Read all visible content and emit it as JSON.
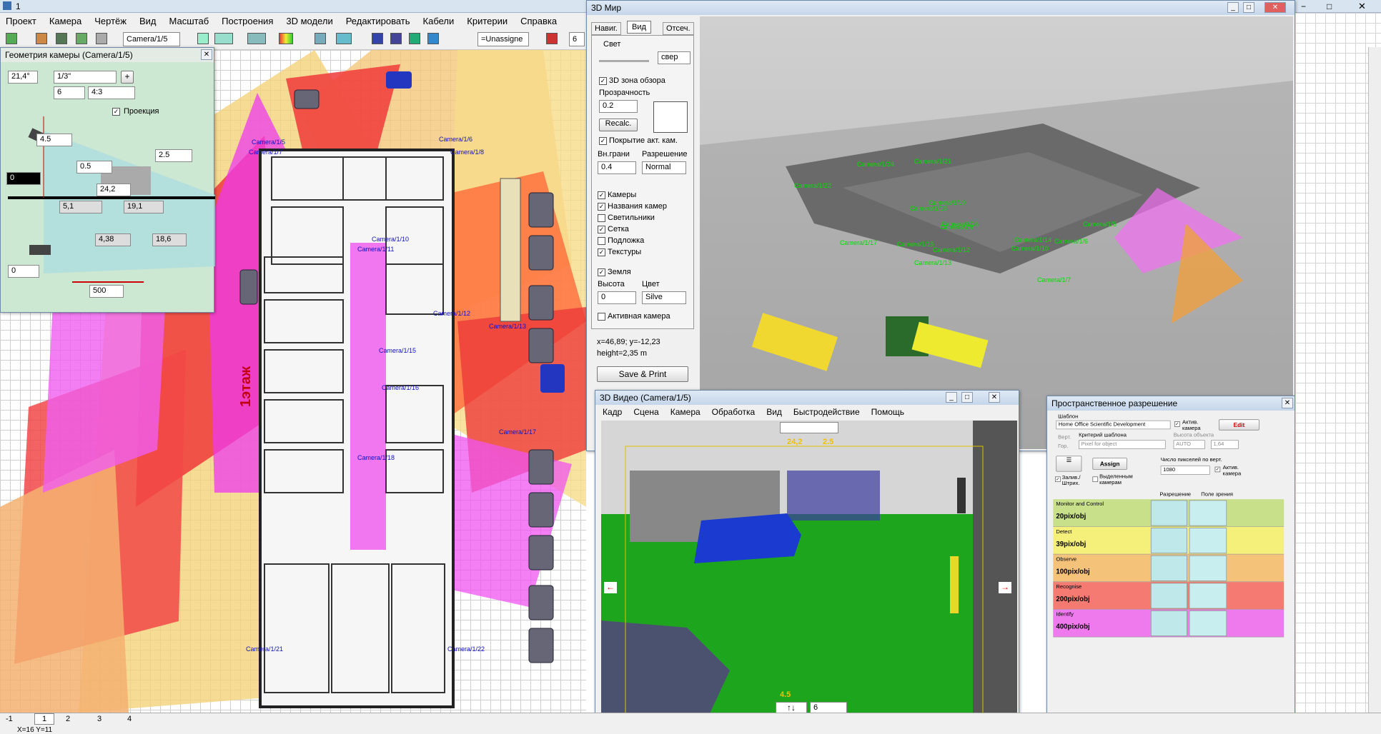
{
  "app": {
    "title": "1",
    "window_controls": [
      "−",
      "□",
      "✕"
    ]
  },
  "menu": [
    "Проект",
    "Камера",
    "Чертёж",
    "Вид",
    "Масштаб",
    "Построения",
    "3D модели",
    "Редактировать",
    "Кабели",
    "Критерии",
    "Справка"
  ],
  "toolbar": {
    "camera_select": "Camera/1/5",
    "layer_select": "=Unassigne",
    "num_select": "6"
  },
  "geometry_panel": {
    "title": "Геометрия камеры (Camera/1/5)",
    "angle": "21,4°",
    "sensor": "1/3\"",
    "focal": "6",
    "aspect": "4:3",
    "projection_label": "Проекция",
    "height": "4.5",
    "tilt_height": "2.5",
    "offset": "0.5",
    "ground": "0",
    "distance": "24,2",
    "val_a": "5,1",
    "val_b": "19,1",
    "val_c": "4,38",
    "val_d": "18,6",
    "rotation": "0",
    "range": "500"
  },
  "floor_label": "1этаж",
  "camera_labels": [
    "Camera/1/5",
    "Camera/1/6",
    "Camera/1/8",
    "Camera/1/10",
    "Camera/1/11",
    "Camera/1/12",
    "Camera/1/13",
    "Camera/1/15",
    "Camera/1/16",
    "Camera/1/17",
    "Camera/1/18",
    "Camera/1/21",
    "Camera/1/22",
    "Camera/1/7"
  ],
  "world3d": {
    "title": "3D Мир",
    "tabs": [
      "Навиг.",
      "Вид",
      "Отсеч."
    ],
    "light_label": "Свет",
    "light_dir": "свер",
    "zone_label": "3D зона обзора",
    "transparency_label": "Прозрачность",
    "transparency_value": "0.2",
    "recalc_label": "Recalc.",
    "coverage_label": "Покрытие акт. кам.",
    "inner_label": "Вн.грани",
    "inner_value": "0.4",
    "resolution_label": "Разрешение",
    "resolution_value": "Normal",
    "checks": [
      "Камеры",
      "Названия камер",
      "Светильники",
      "Сетка",
      "Подложка",
      "Текстуры"
    ],
    "ground_label": "Земля",
    "height_label": "Высота",
    "height_value": "0",
    "color_label": "Цвет",
    "color_value": "Silve",
    "active_camera_label": "Активная камера",
    "coords": "x=46,89;  y=-12,23",
    "height_readout": "height=2,35 m",
    "save_print": "Save & Print",
    "scene_labels": [
      "Camera/1/24",
      "Camera/1/21",
      "Camera/1/22",
      "Camera/1/19",
      "Camera/1/18",
      "Camera/1/16",
      "Camera/1/15",
      "Camera/1/17",
      "Camera/1/12",
      "Camera/1/14",
      "Camera/1/10",
      "Camera/1/13",
      "Camera/1/5",
      "Camera/1/6",
      "Camera/1/7",
      "Camera/1/8"
    ]
  },
  "video3d": {
    "title": "3D Видео (Camera/1/5)",
    "menu": [
      "Кадр",
      "Сцена",
      "Камера",
      "Обработка",
      "Вид",
      "Быстродействие",
      "Помощь"
    ],
    "top_readout_a": "24,2",
    "top_readout_b": "2.5",
    "bottom_readout": "4.5",
    "bottom_select": "6"
  },
  "spatial": {
    "title": "Пространственное разрешение",
    "template_label": "Шаблон",
    "template_value": "Home Office Scientific Development",
    "active_camera": "Актив. камера",
    "edit": "Edit",
    "vert": "Верт.",
    "hor": "Гор.",
    "criterion_label": "Критерий шаблона",
    "criterion_value": "Pixel for object",
    "obj_height_label": "Высота объекта",
    "auto": "AUTO",
    "obj_height": "1,64",
    "assign": "Assign",
    "fill_label": "Залив./Штрих.",
    "selected_label": "Выделенным камерам",
    "pixels_label": "Число пикселей по верт.",
    "pixels_value": "1080",
    "active_camera2": "Актив. камера",
    "col_resolution": "Разрешение",
    "col_fov": "Поле зрения",
    "rows": [
      {
        "name": "Monitor and Control",
        "value": "20pix/obj",
        "color": "#c9e08a"
      },
      {
        "name": "Detect",
        "value": "39pix/obj",
        "color": "#f5f07a"
      },
      {
        "name": "Observe",
        "value": "100pix/obj",
        "color": "#f5c27a"
      },
      {
        "name": "Recognise",
        "value": "200pix/obj",
        "color": "#f47a72"
      },
      {
        "name": "Identify",
        "value": "400pix/obj",
        "color": "#ee7aee"
      }
    ]
  },
  "status": {
    "tabs": [
      "-1",
      "1",
      "2",
      "3",
      "4"
    ],
    "coords": "X=16   Y=11"
  }
}
